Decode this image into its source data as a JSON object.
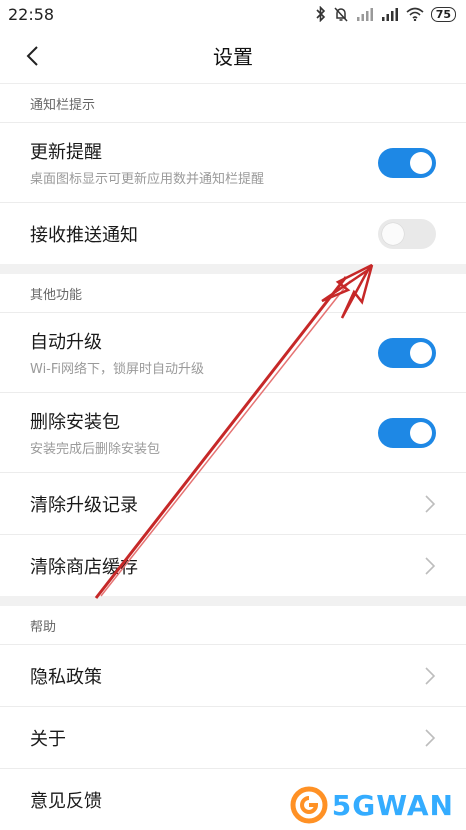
{
  "status_bar": {
    "time": "22:58",
    "battery": "75"
  },
  "header": {
    "title": "设置"
  },
  "sections": {
    "notify": {
      "label": "通知栏提示",
      "update_title": "更新提醒",
      "update_sub": "桌面图标显示可更新应用数并通知栏提醒",
      "update_on": true,
      "push_title": "接收推送通知",
      "push_on": false
    },
    "other": {
      "label": "其他功能",
      "auto_title": "自动升级",
      "auto_sub": "Wi-Fi网络下，锁屏时自动升级",
      "auto_on": true,
      "delete_title": "删除安装包",
      "delete_sub": "安装完成后删除安装包",
      "delete_on": true,
      "clear_history": "清除升级记录",
      "clear_cache": "清除商店缓存"
    },
    "help": {
      "label": "帮助",
      "privacy": "隐私政策",
      "about": "关于",
      "feedback": "意见反馈"
    }
  },
  "watermark": {
    "text": "5GWAN",
    "icon": "5gwan-logo-icon"
  },
  "colors": {
    "toggle_on": "#1e88e5",
    "toggle_off": "#e9e9e9",
    "annotation_arrow": "#c62828"
  }
}
